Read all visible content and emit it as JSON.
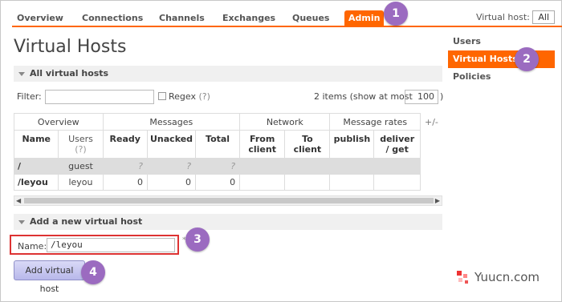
{
  "nav": {
    "tabs": [
      "Overview",
      "Connections",
      "Channels",
      "Exchanges",
      "Queues",
      "Admin"
    ],
    "active_tab": "Admin",
    "vhost_label": "Virtual host:",
    "vhost_value": "All"
  },
  "page_title": "Virtual Hosts",
  "sidebar": {
    "items": [
      {
        "label": "Users"
      },
      {
        "label": "Virtual Hosts"
      },
      {
        "label": "Policies"
      }
    ],
    "active_item": "Virtual Hosts"
  },
  "all_vhosts": {
    "section_title": "All virtual hosts",
    "filter_label": "Filter:",
    "filter_value": "",
    "regex_label": "Regex",
    "regex_help": "(?)",
    "items_text": "2 items (show at most",
    "max_value": "100",
    "close_paren": ")",
    "plus_minus": "+/-",
    "table": {
      "groups": [
        "Overview",
        "Messages",
        "Network",
        "Message rates"
      ],
      "columns": [
        "Name",
        "Users",
        "(?)",
        "Ready",
        "Unacked",
        "Total",
        "From client",
        "To client",
        "publish",
        "deliver / get"
      ],
      "rows": [
        {
          "name": "/",
          "users": "guest",
          "ready": "?",
          "unacked": "?",
          "total": "?"
        },
        {
          "name": "/leyou",
          "users": "leyou",
          "ready": "0",
          "unacked": "0",
          "total": "0"
        }
      ]
    }
  },
  "add_vhost": {
    "section_title": "Add a new virtual host",
    "name_label": "Name:",
    "name_value": "/leyou",
    "required_mark": "*",
    "button_label": "Add virtual host"
  },
  "badges": [
    "1",
    "2",
    "3",
    "4"
  ],
  "watermark": {
    "text": "Yuucn.com"
  },
  "colors": {
    "accent": "#ff6600",
    "badge": "#9b6bc0",
    "highlight_border": "#dd3333",
    "button": "#b8b8ea"
  }
}
